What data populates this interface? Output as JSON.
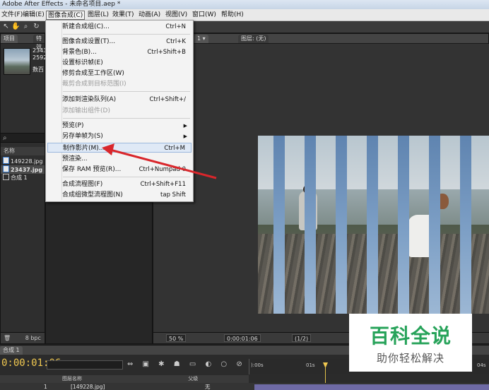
{
  "window": {
    "title": "Adobe After Effects - 未命名项目.aep *"
  },
  "menubar": {
    "items": [
      "文件(F)",
      "编辑(E)",
      "图像合成(C)",
      "图层(L)",
      "效果(T)",
      "动画(A)",
      "视图(V)",
      "窗口(W)",
      "帮助(H)"
    ]
  },
  "project_panel": {
    "tabs": [
      "项目",
      "特效"
    ],
    "thumb_info_1": "2343",
    "thumb_info_2": "2592",
    "thumb_info_3": "数百",
    "search_icon_glyph": "⌕",
    "column_name": "名称",
    "files": [
      {
        "name": "149228.jpg",
        "type": "image"
      },
      {
        "name": "23437.jpg",
        "type": "image"
      },
      {
        "name": "合成 1",
        "type": "comp"
      }
    ],
    "bpc": "8 bpc"
  },
  "viewer": {
    "tab_comp": "1 ▾",
    "tab_layer": "图层: (无)",
    "zoom": "50 %",
    "timecode": "0:00:01:06",
    "resolution": "(1/2)"
  },
  "composition_menu": {
    "items": [
      {
        "label": "新建合成组(C)...",
        "shortcut": "Ctrl+N",
        "disabled": false,
        "submenu": false
      },
      {
        "label": "图像合成设置(T)...",
        "shortcut": "Ctrl+K",
        "disabled": false,
        "submenu": false
      },
      {
        "label": "背景色(B)...",
        "shortcut": "Ctrl+Shift+B",
        "disabled": false,
        "submenu": false
      },
      {
        "label": "设置标识帧(E)",
        "shortcut": "",
        "disabled": false,
        "submenu": false
      },
      {
        "label": "修剪合成至工作区(W)",
        "shortcut": "",
        "disabled": false,
        "submenu": false
      },
      {
        "label": "裁剪合成到目标范围(I)",
        "shortcut": "",
        "disabled": true,
        "submenu": false
      },
      {
        "label": "添加到渲染队列(A)",
        "shortcut": "Ctrl+Shift+/",
        "disabled": false,
        "submenu": false
      },
      {
        "label": "添加输出组件(D)",
        "shortcut": "",
        "disabled": true,
        "submenu": false
      },
      {
        "label": "预览(P)",
        "shortcut": "",
        "disabled": false,
        "submenu": true
      },
      {
        "label": "另存单帧为(S)",
        "shortcut": "",
        "disabled": false,
        "submenu": true
      },
      {
        "label": "制作影片(M)...",
        "shortcut": "Ctrl+M",
        "disabled": false,
        "submenu": false,
        "highlighted": true
      },
      {
        "label": "预渲染...",
        "shortcut": "",
        "disabled": false,
        "submenu": false
      },
      {
        "label": "保存 RAM 预览(R)...",
        "shortcut": "Ctrl+Numpad 0",
        "disabled": false,
        "submenu": false
      },
      {
        "label": "合成流程图(F)",
        "shortcut": "Ctrl+Shift+F11",
        "disabled": false,
        "submenu": false
      },
      {
        "label": "合成组微型流程图(N)",
        "shortcut": "tap Shift",
        "disabled": false,
        "submenu": false
      }
    ]
  },
  "timeline": {
    "tab": "合成 1",
    "current_time": "0:00:01:06",
    "ruler_start": "):00s",
    "ruler_mark": "01s",
    "ruler_end": "04s",
    "col_layer": "图层名称",
    "col_parent": "父级",
    "layer_index": "1",
    "layer_name": "[149228.jpg]",
    "layer_parent": "无"
  },
  "watermark": {
    "title": "百科全说",
    "subtitle": "助你轻松解决",
    "color": "#27a35a"
  },
  "annotation": {
    "arrow_color": "#d9262b"
  }
}
